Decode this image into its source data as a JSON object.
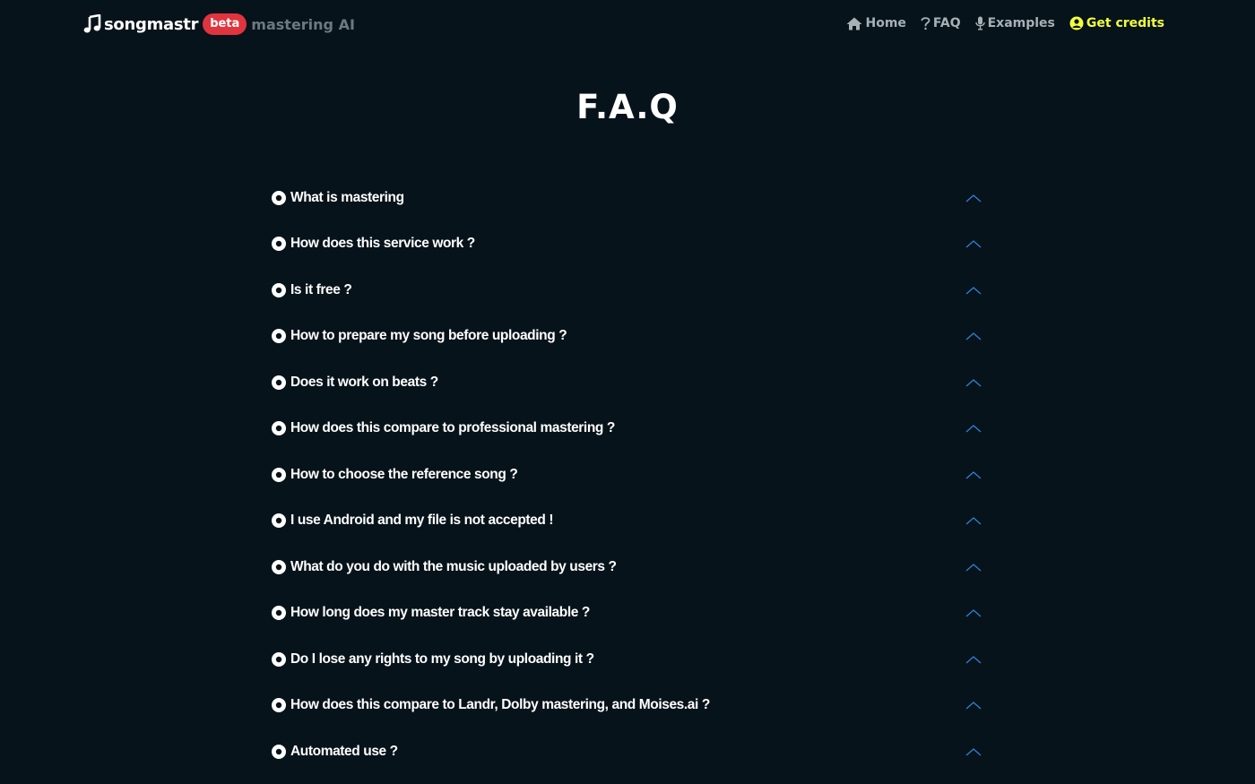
{
  "header": {
    "brand_name": "songmastr",
    "brand_badge": "beta",
    "brand_tagline": "mastering AI",
    "nav": [
      {
        "label": "Home",
        "icon": "home-icon"
      },
      {
        "label": "FAQ",
        "icon": "question-icon"
      },
      {
        "label": "Examples",
        "icon": "microphone-icon"
      },
      {
        "label": "Get credits",
        "icon": "user-circle-icon"
      }
    ]
  },
  "main": {
    "title": "F.A.Q",
    "faq_items": [
      "What is mastering",
      "How does this service work ?",
      "Is it free ?",
      "How to prepare my song before uploading ?",
      "Does it work on beats ?",
      "How does this compare to professional mastering ?",
      "How to choose the reference song ?",
      "I use Android and my file is not accepted !",
      "What do you do with the music uploaded by users ?",
      "How long does my master track stay available ?",
      "Do I lose any rights to my song by uploading it ?",
      "How does this compare to Landr, Dolby mastering, and Moises.ai ?",
      "Automated use ?"
    ]
  },
  "colors": {
    "background": "#07131a",
    "badge": "#e0343f",
    "credits": "#f2ff3f",
    "chevron": "#2f7fd6",
    "nav_text": "#a7b0b6",
    "tagline": "#6d7880"
  }
}
